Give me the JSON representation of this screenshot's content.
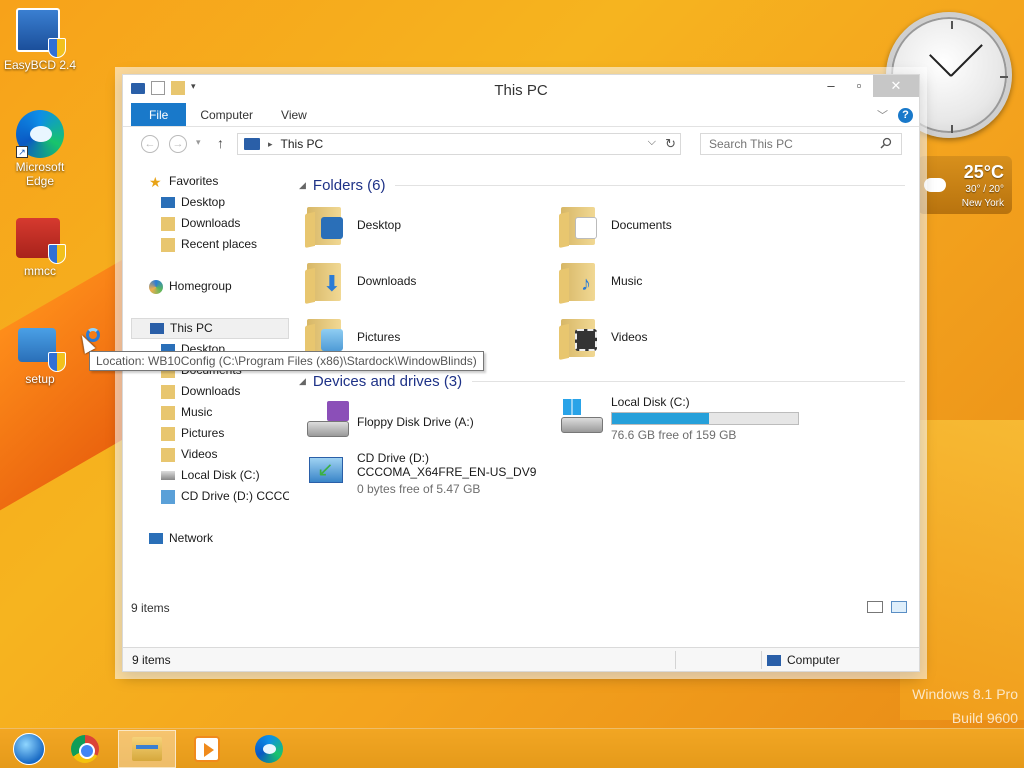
{
  "desktop": {
    "icons": [
      {
        "label": "EasyBCD 2.4",
        "icon": "easybcd-icon"
      },
      {
        "label": "Microsoft Edge",
        "icon": "edge-icon"
      },
      {
        "label": "mmcc",
        "icon": "toolbox-icon"
      },
      {
        "label": "setup",
        "icon": "setup-icon"
      }
    ],
    "weather": {
      "temp": "25°C",
      "range": "30° / 20°",
      "city": "New York"
    },
    "watermark": {
      "line1": "Windows 8.1 Pro",
      "line2": "Build 9600"
    }
  },
  "window": {
    "title": "This PC",
    "ribbon_tabs": [
      "File",
      "Computer",
      "View"
    ],
    "address": "This PC",
    "search_placeholder": "Search This PC",
    "nav_pane": {
      "favorites": "Favorites",
      "fav_items": [
        "Desktop",
        "Downloads",
        "Recent places"
      ],
      "homegroup": "Homegroup",
      "this_pc": "This PC",
      "pc_items": [
        "Desktop",
        "Documents",
        "Downloads",
        "Music",
        "Pictures",
        "Videos",
        "Local Disk (C:)",
        "CD Drive (D:) CCCOI"
      ],
      "network": "Network"
    },
    "folders_header": "Folders (6)",
    "folders": [
      "Desktop",
      "Documents",
      "Downloads",
      "Music",
      "Pictures",
      "Videos"
    ],
    "devices_header": "Devices and drives (3)",
    "drives": {
      "floppy": {
        "name": "Floppy Disk Drive (A:)"
      },
      "local": {
        "name": "Local Disk (C:)",
        "free": "76.6 GB free of 159 GB",
        "used_fraction": 0.52
      },
      "cd": {
        "name": "CD Drive (D:)",
        "label": "CCCOMA_X64FRE_EN-US_DV9",
        "free": "0 bytes free of 5.47 GB"
      }
    },
    "content_status": "9 items",
    "status_left": "9 items",
    "status_right": "Computer"
  },
  "tooltip": "Location: WB10Config (C:\\Program Files (x86)\\Stardock\\WindowBlinds)",
  "colors": {
    "accent": "#1979ca",
    "progress": "#26a0da",
    "header": "#1e3287"
  }
}
